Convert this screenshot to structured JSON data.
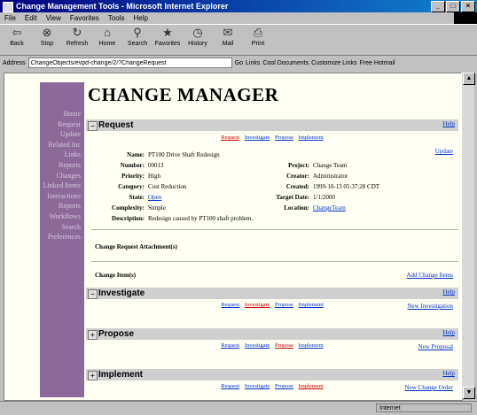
{
  "window": {
    "title": "Change Management Tools - Microsoft Internet Explorer",
    "buttons": [
      "_",
      "□",
      "×"
    ]
  },
  "menu": [
    "File",
    "Edit",
    "View",
    "Favorites",
    "Tools",
    "Help"
  ],
  "toolbar": [
    {
      "label": "Back",
      "icon": "⇦"
    },
    {
      "label": "Stop",
      "icon": "⊗"
    },
    {
      "label": "Refresh",
      "icon": "↻"
    },
    {
      "label": "Home",
      "icon": "⌂"
    },
    {
      "label": "Search",
      "icon": "⚲"
    },
    {
      "label": "Favorites",
      "icon": "★"
    },
    {
      "label": "History",
      "icon": "◷"
    },
    {
      "label": "Mail",
      "icon": "✉"
    },
    {
      "label": "Print",
      "icon": "⎙"
    }
  ],
  "address": {
    "label": "Address",
    "value": "ChangeObjects/evpd-change/2/?ChangeRequest",
    "go": "Go",
    "links_label": "Links",
    "links": [
      "Cool Documents",
      "Customize Links",
      "Free Hotmail"
    ]
  },
  "sidebar": [
    "Home",
    "Request",
    "Update",
    "Related Inc",
    "Links",
    "Reports",
    "Changes",
    "Linked Items",
    "Interactions",
    "Reports",
    "Workflows",
    "Search",
    "Preferences"
  ],
  "page": {
    "title": "CHANGE MANAGER",
    "help_label": "Help",
    "request": {
      "header": "Request",
      "nav": [
        "Request",
        "Investigate",
        "Propose",
        "Implement"
      ],
      "update_label": "Update",
      "fields_left": [
        {
          "label": "Name:",
          "value": "PT100 Drive Shaft Redesign",
          "link": false
        },
        {
          "label": "Number:",
          "value": "00013",
          "link": false
        },
        {
          "label": "Priority:",
          "value": "High",
          "link": false
        },
        {
          "label": "Category:",
          "value": "Cost Reduction",
          "link": false
        },
        {
          "label": "State:",
          "value": "Open",
          "link": true
        },
        {
          "label": "Complexity:",
          "value": "Simple",
          "link": false
        }
      ],
      "fields_right": [
        {
          "label": "Project:",
          "value": "Change Team",
          "link": false
        },
        {
          "label": "Creator:",
          "value": "Administrator",
          "link": false
        },
        {
          "label": "Created:",
          "value": "1999-10-13 05:37:28 CDT",
          "link": false
        },
        {
          "label": "Target Date:",
          "value": "1/1/2000",
          "link": false
        },
        {
          "label": "Location:",
          "value": "ChangeTeam",
          "link": true
        }
      ],
      "description_label": "Description:",
      "description": "Redesign caused by PT100 shaft problem.",
      "attachments_label": "Change Request Attachment(s)",
      "items_label": "Change Item(s)",
      "add_items": "Add Change Items"
    },
    "investigate": {
      "header": "Investigate",
      "action": "New Investigation"
    },
    "propose": {
      "header": "Propose",
      "action": "New Proposal"
    },
    "implement": {
      "header": "Implement",
      "action": "New Change Order"
    }
  },
  "status": {
    "zone": "Internet"
  }
}
